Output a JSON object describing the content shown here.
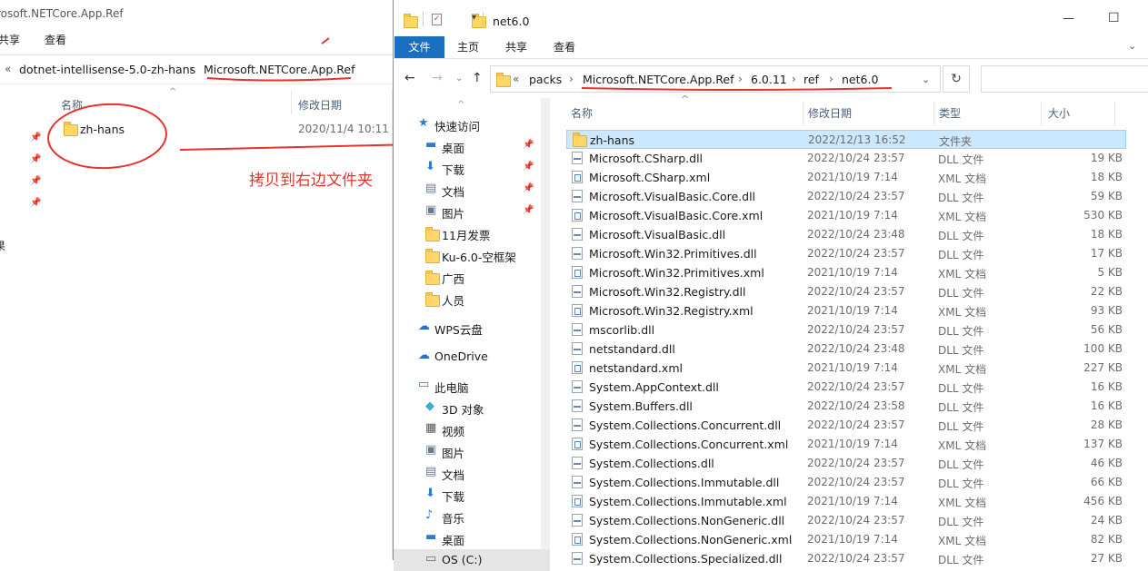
{
  "back_window": {
    "title": "rosoft.NETCore.App.Ref",
    "tabs": [
      "共享",
      "查看"
    ],
    "address": {
      "crumbs": [
        "dotnet-intellisense-5.0-zh-hans",
        "Microsoft.NETCore.App.Ref"
      ]
    },
    "columns": {
      "name": "名称",
      "date": "修改日期"
    },
    "items": [
      {
        "name": "zh-hans",
        "date": "2020/11/4 10:11"
      }
    ],
    "left_stub": "果"
  },
  "annotation": {
    "text": "拷贝到右边文件夹",
    "color": "#e8322b"
  },
  "front_window": {
    "title": "net6.0",
    "controls": {
      "minimize": "—",
      "maximize": "☐"
    },
    "ribbon_tabs": [
      "文件",
      "主页",
      "共享",
      "查看"
    ],
    "address": {
      "crumbs": [
        "packs",
        "Microsoft.NETCore.App.Ref",
        "6.0.11",
        "ref",
        "net6.0"
      ]
    },
    "nav_pane": [
      {
        "label": "快速访问",
        "icon": "star-icon"
      },
      {
        "label": "桌面",
        "icon": "desktop-icon",
        "pinned": true
      },
      {
        "label": "下载",
        "icon": "download-icon",
        "pinned": true
      },
      {
        "label": "文档",
        "icon": "document-icon",
        "pinned": true
      },
      {
        "label": "图片",
        "icon": "picture-icon",
        "pinned": true
      },
      {
        "label": "11月发票",
        "icon": "folder-icon"
      },
      {
        "label": "Ku-6.0-空框架",
        "icon": "folder-icon"
      },
      {
        "label": "广西",
        "icon": "folder-icon"
      },
      {
        "label": "人员",
        "icon": "folder-icon"
      },
      {
        "label": "WPS云盘",
        "icon": "cloud-icon"
      },
      {
        "label": "OneDrive",
        "icon": "cloud-icon"
      },
      {
        "label": "此电脑",
        "icon": "computer-icon"
      },
      {
        "label": "3D 对象",
        "icon": "3d-icon"
      },
      {
        "label": "视频",
        "icon": "video-icon"
      },
      {
        "label": "图片",
        "icon": "picture-icon"
      },
      {
        "label": "文档",
        "icon": "document-icon"
      },
      {
        "label": "下载",
        "icon": "download-icon"
      },
      {
        "label": "音乐",
        "icon": "music-icon"
      },
      {
        "label": "桌面",
        "icon": "desktop-icon"
      },
      {
        "label": "OS (C:)",
        "icon": "drive-icon"
      }
    ],
    "columns": {
      "name": "名称",
      "date": "修改日期",
      "type": "类型",
      "size": "大小"
    },
    "files": [
      {
        "name": "zh-hans",
        "date": "2022/12/13 16:52",
        "type": "文件夹",
        "size": "",
        "kind": "folder"
      },
      {
        "name": "Microsoft.CSharp.dll",
        "date": "2022/10/24 23:57",
        "type": "DLL 文件",
        "size": "19 KB",
        "kind": "dll"
      },
      {
        "name": "Microsoft.CSharp.xml",
        "date": "2021/10/19 7:14",
        "type": "XML 文档",
        "size": "18 KB",
        "kind": "xml"
      },
      {
        "name": "Microsoft.VisualBasic.Core.dll",
        "date": "2022/10/24 23:57",
        "type": "DLL 文件",
        "size": "59 KB",
        "kind": "dll"
      },
      {
        "name": "Microsoft.VisualBasic.Core.xml",
        "date": "2021/10/19 7:14",
        "type": "XML 文档",
        "size": "530 KB",
        "kind": "xml"
      },
      {
        "name": "Microsoft.VisualBasic.dll",
        "date": "2022/10/24 23:48",
        "type": "DLL 文件",
        "size": "18 KB",
        "kind": "dll"
      },
      {
        "name": "Microsoft.Win32.Primitives.dll",
        "date": "2022/10/24 23:57",
        "type": "DLL 文件",
        "size": "17 KB",
        "kind": "dll"
      },
      {
        "name": "Microsoft.Win32.Primitives.xml",
        "date": "2021/10/19 7:14",
        "type": "XML 文档",
        "size": "5 KB",
        "kind": "xml"
      },
      {
        "name": "Microsoft.Win32.Registry.dll",
        "date": "2022/10/24 23:57",
        "type": "DLL 文件",
        "size": "22 KB",
        "kind": "dll"
      },
      {
        "name": "Microsoft.Win32.Registry.xml",
        "date": "2021/10/19 7:14",
        "type": "XML 文档",
        "size": "93 KB",
        "kind": "xml"
      },
      {
        "name": "mscorlib.dll",
        "date": "2022/10/24 23:57",
        "type": "DLL 文件",
        "size": "56 KB",
        "kind": "dll"
      },
      {
        "name": "netstandard.dll",
        "date": "2022/10/24 23:48",
        "type": "DLL 文件",
        "size": "100 KB",
        "kind": "dll"
      },
      {
        "name": "netstandard.xml",
        "date": "2021/10/19 7:14",
        "type": "XML 文档",
        "size": "227 KB",
        "kind": "xml"
      },
      {
        "name": "System.AppContext.dll",
        "date": "2022/10/24 23:57",
        "type": "DLL 文件",
        "size": "16 KB",
        "kind": "dll"
      },
      {
        "name": "System.Buffers.dll",
        "date": "2022/10/24 23:58",
        "type": "DLL 文件",
        "size": "16 KB",
        "kind": "dll"
      },
      {
        "name": "System.Collections.Concurrent.dll",
        "date": "2022/10/24 23:57",
        "type": "DLL 文件",
        "size": "28 KB",
        "kind": "dll"
      },
      {
        "name": "System.Collections.Concurrent.xml",
        "date": "2021/10/19 7:14",
        "type": "XML 文档",
        "size": "137 KB",
        "kind": "xml"
      },
      {
        "name": "System.Collections.dll",
        "date": "2022/10/24 23:57",
        "type": "DLL 文件",
        "size": "46 KB",
        "kind": "dll"
      },
      {
        "name": "System.Collections.Immutable.dll",
        "date": "2022/10/24 23:57",
        "type": "DLL 文件",
        "size": "66 KB",
        "kind": "dll"
      },
      {
        "name": "System.Collections.Immutable.xml",
        "date": "2021/10/19 7:14",
        "type": "XML 文档",
        "size": "456 KB",
        "kind": "xml"
      },
      {
        "name": "System.Collections.NonGeneric.dll",
        "date": "2022/10/24 23:57",
        "type": "DLL 文件",
        "size": "24 KB",
        "kind": "dll"
      },
      {
        "name": "System.Collections.NonGeneric.xml",
        "date": "2021/10/19 7:14",
        "type": "XML 文档",
        "size": "82 KB",
        "kind": "xml"
      },
      {
        "name": "System.Collections.Specialized.dll",
        "date": "2022/10/24 23:57",
        "type": "DLL 文件",
        "size": "27 KB",
        "kind": "dll"
      }
    ]
  }
}
